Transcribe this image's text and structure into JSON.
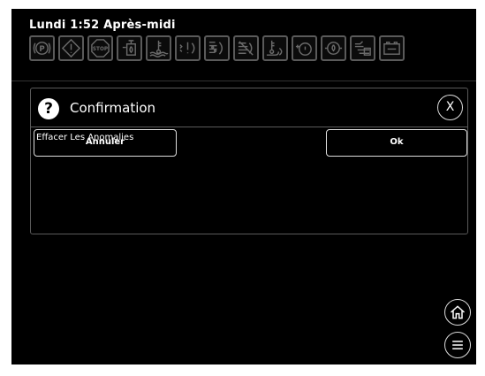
{
  "status": {
    "clock": "Lundi 1:52 Après-midi"
  },
  "indicators": [
    {
      "name": "park-brake-icon",
      "label": "P"
    },
    {
      "name": "warning-icon"
    },
    {
      "name": "stop-icon",
      "label": "STOP"
    },
    {
      "name": "fuel-water-icon"
    },
    {
      "name": "coolant-temp-icon"
    },
    {
      "name": "def-warning-icon"
    },
    {
      "name": "dpf-icon"
    },
    {
      "name": "dpf-disabled-icon"
    },
    {
      "name": "exhaust-temp-icon"
    },
    {
      "name": "oil-pressure-icon"
    },
    {
      "name": "oil-filter-icon"
    },
    {
      "name": "air-filter-icon"
    },
    {
      "name": "battery-icon"
    }
  ],
  "dialog": {
    "title": "Confirmation",
    "message": "Effacer Les Anomalies",
    "close_label": "X",
    "cancel_label": "Annuler",
    "ok_label": "Ok"
  },
  "colors": {
    "background": "#000000",
    "foreground": "#ffffff",
    "inactive_icon": "#5a5a5a"
  }
}
